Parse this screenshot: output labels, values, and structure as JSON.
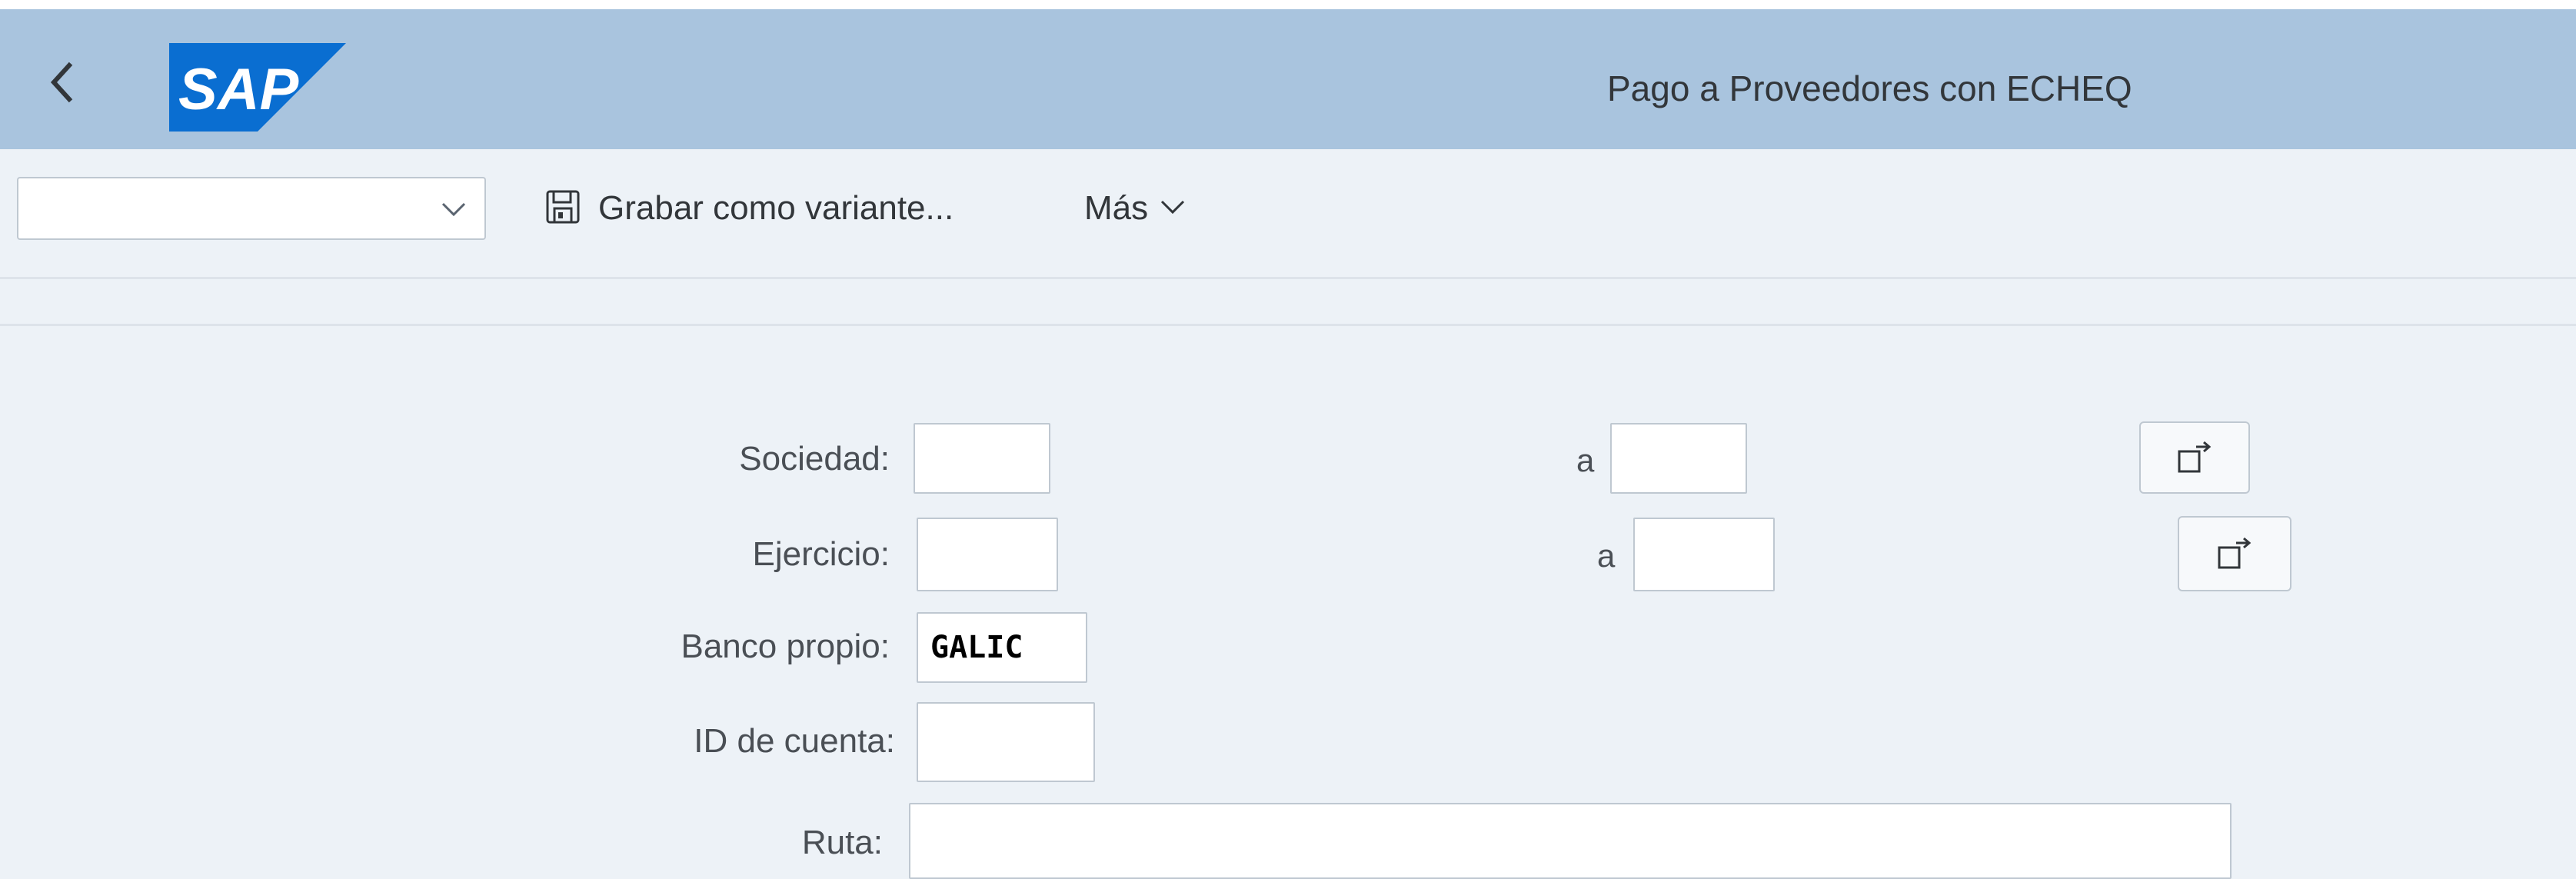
{
  "shell": {
    "title": "Pago a Proveedores con ECHEQ",
    "back_icon": "chevron-left-icon",
    "logo_text": "SAP",
    "logo_color": "#0a6ed1",
    "bar_color": "#a9c4de"
  },
  "toolbar": {
    "variant_value": "",
    "save_variant_label": "Grabar como variante...",
    "save_icon": "floppy-disk-icon",
    "more_label": "Más",
    "more_icon": "chevron-down-icon"
  },
  "form": {
    "sociedad": {
      "label": "Sociedad:",
      "from": "",
      "to_label": "a",
      "to": "",
      "multi_icon": "multiple-selection-icon"
    },
    "ejercicio": {
      "label": "Ejercicio:",
      "from": "",
      "to_label": "a",
      "to": "",
      "multi_icon": "multiple-selection-icon"
    },
    "banco_propio": {
      "label": "Banco propio:",
      "value": "GALIC"
    },
    "id_cuenta": {
      "label": "ID de cuenta:",
      "value": ""
    },
    "ruta": {
      "label": "Ruta:",
      "value": ""
    }
  }
}
